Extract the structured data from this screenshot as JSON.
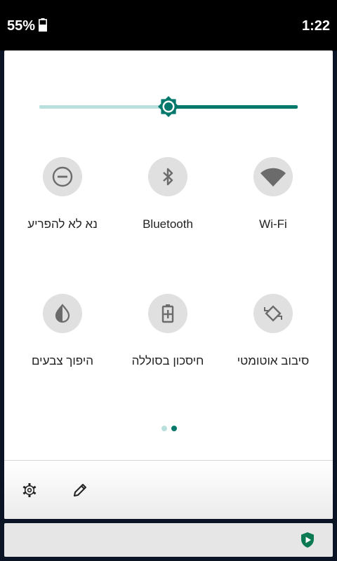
{
  "status_bar": {
    "battery_percent": "55%",
    "battery_level": 0.55,
    "time": "1:22"
  },
  "brightness": {
    "level": 0.5,
    "icon": "brightness-icon",
    "accent": "#00796b",
    "track_inactive": "#b9e0dc"
  },
  "tiles": [
    {
      "label": "נא לא להפריע",
      "icon": "do-not-disturb-icon"
    },
    {
      "label": "Bluetooth",
      "icon": "bluetooth-icon"
    },
    {
      "label": "Wi-Fi",
      "icon": "wifi-icon"
    },
    {
      "label": "היפוך צבעים",
      "icon": "invert-colors-icon"
    },
    {
      "label": "חיסכון בסוללה",
      "icon": "battery-saver-icon"
    },
    {
      "label": "סיבוב אוטומטי",
      "icon": "auto-rotate-icon"
    }
  ],
  "pager": {
    "pages": 2,
    "active": 2
  },
  "footer": {
    "settings_icon": "gear-icon",
    "edit_icon": "pencil-icon"
  },
  "notification": {
    "icon": "shield-play-icon",
    "color": "#0b7a53"
  },
  "colors": {
    "tile_bg": "#e0e0e0",
    "icon_gray": "#6b6b6b"
  }
}
